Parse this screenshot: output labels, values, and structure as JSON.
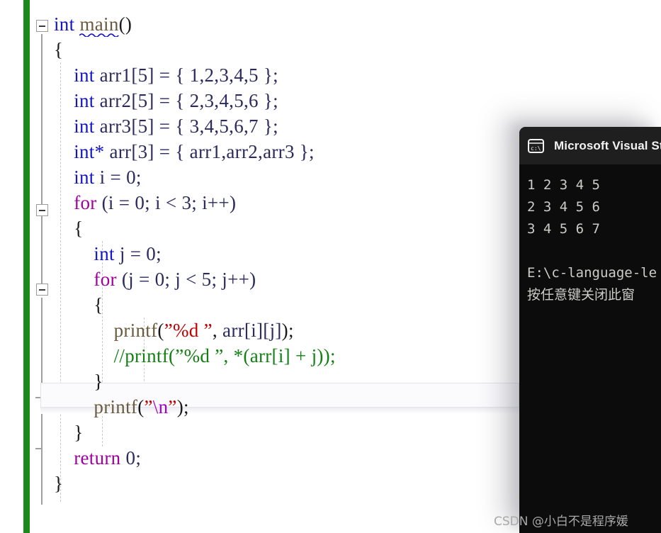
{
  "editor": {
    "change_bar_color": "#1a8a1a",
    "background": "#ffffff",
    "code_lines": [
      {
        "indent": 0,
        "tokens": [
          {
            "t": "int ",
            "c": "kw-blue"
          },
          {
            "t": "main",
            "c": "squiggle"
          },
          {
            "t": "()",
            "c": "plain"
          }
        ]
      },
      {
        "indent": 0,
        "tokens": [
          {
            "t": "{",
            "c": "plain"
          }
        ]
      },
      {
        "indent": 1,
        "tokens": [
          {
            "t": "int ",
            "c": "kw-blue"
          },
          {
            "t": "arr1[5] = { 1,2,3,4,5 };",
            "c": "ident"
          }
        ]
      },
      {
        "indent": 1,
        "tokens": [
          {
            "t": "int ",
            "c": "kw-blue"
          },
          {
            "t": "arr2[5] = { 2,3,4,5,6 };",
            "c": "ident"
          }
        ]
      },
      {
        "indent": 1,
        "tokens": [
          {
            "t": "int ",
            "c": "kw-blue"
          },
          {
            "t": "arr3[5] = { 3,4,5,6,7 };",
            "c": "ident"
          }
        ]
      },
      {
        "indent": 1,
        "tokens": [
          {
            "t": "int* ",
            "c": "kw-blue"
          },
          {
            "t": "arr[3] = { arr1,arr2,arr3 };",
            "c": "ident"
          }
        ]
      },
      {
        "indent": 1,
        "tokens": [
          {
            "t": "int ",
            "c": "kw-blue"
          },
          {
            "t": "i = 0;",
            "c": "ident"
          }
        ]
      },
      {
        "indent": 1,
        "tokens": [
          {
            "t": "for",
            "c": "kw-purple"
          },
          {
            "t": " (i = 0; i < 3; i++)",
            "c": "ident"
          }
        ]
      },
      {
        "indent": 1,
        "tokens": [
          {
            "t": "{",
            "c": "plain"
          }
        ]
      },
      {
        "indent": 2,
        "tokens": [
          {
            "t": "int ",
            "c": "kw-blue"
          },
          {
            "t": "j = 0;",
            "c": "ident"
          }
        ]
      },
      {
        "indent": 2,
        "tokens": [
          {
            "t": "for",
            "c": "kw-purple"
          },
          {
            "t": " (j = 0; j < 5; j++)",
            "c": "ident"
          }
        ]
      },
      {
        "indent": 2,
        "tokens": [
          {
            "t": "{",
            "c": "plain"
          }
        ]
      },
      {
        "indent": 3,
        "tokens": [
          {
            "t": "printf",
            "c": "fn"
          },
          {
            "t": "(",
            "c": "plain"
          },
          {
            "t": "”%d ”",
            "c": "str"
          },
          {
            "t": ", ",
            "c": "plain"
          },
          {
            "t": "arr[i][j]",
            "c": "ident"
          },
          {
            "t": ");",
            "c": "plain"
          }
        ]
      },
      {
        "indent": 3,
        "tokens": [
          {
            "t": "//printf(”%d ”, *(arr[i] + j));",
            "c": "comment"
          }
        ]
      },
      {
        "indent": 2,
        "tokens": [
          {
            "t": "}",
            "c": "plain"
          }
        ]
      },
      {
        "indent": 2,
        "tokens": [
          {
            "t": "printf",
            "c": "fn"
          },
          {
            "t": "(",
            "c": "plain"
          },
          {
            "t": "”",
            "c": "str"
          },
          {
            "t": "\\n",
            "c": "esc"
          },
          {
            "t": "”",
            "c": "str"
          },
          {
            "t": ");",
            "c": "plain"
          }
        ]
      },
      {
        "indent": 1,
        "tokens": [
          {
            "t": "}",
            "c": "plain"
          }
        ]
      },
      {
        "indent": 1,
        "tokens": [
          {
            "t": "return",
            "c": "kw-purple"
          },
          {
            "t": " 0;",
            "c": "ident"
          }
        ]
      },
      {
        "indent": 0,
        "tokens": [
          {
            "t": "}",
            "c": "plain"
          }
        ]
      }
    ]
  },
  "console": {
    "title": "Microsoft Visual Stud",
    "icon": "console-window-icon",
    "output_lines": [
      "1 2 3 4 5",
      "2 3 4 5 6",
      "3 4 5 6 7",
      "",
      "E:\\c-language-le",
      "按任意键关闭此窗"
    ],
    "background": "#0c0c0c",
    "titlebar_background": "#1f1f1f",
    "text_color": "#ccccc8"
  },
  "watermark": {
    "text": "CSDN @小白不是程序媛"
  }
}
